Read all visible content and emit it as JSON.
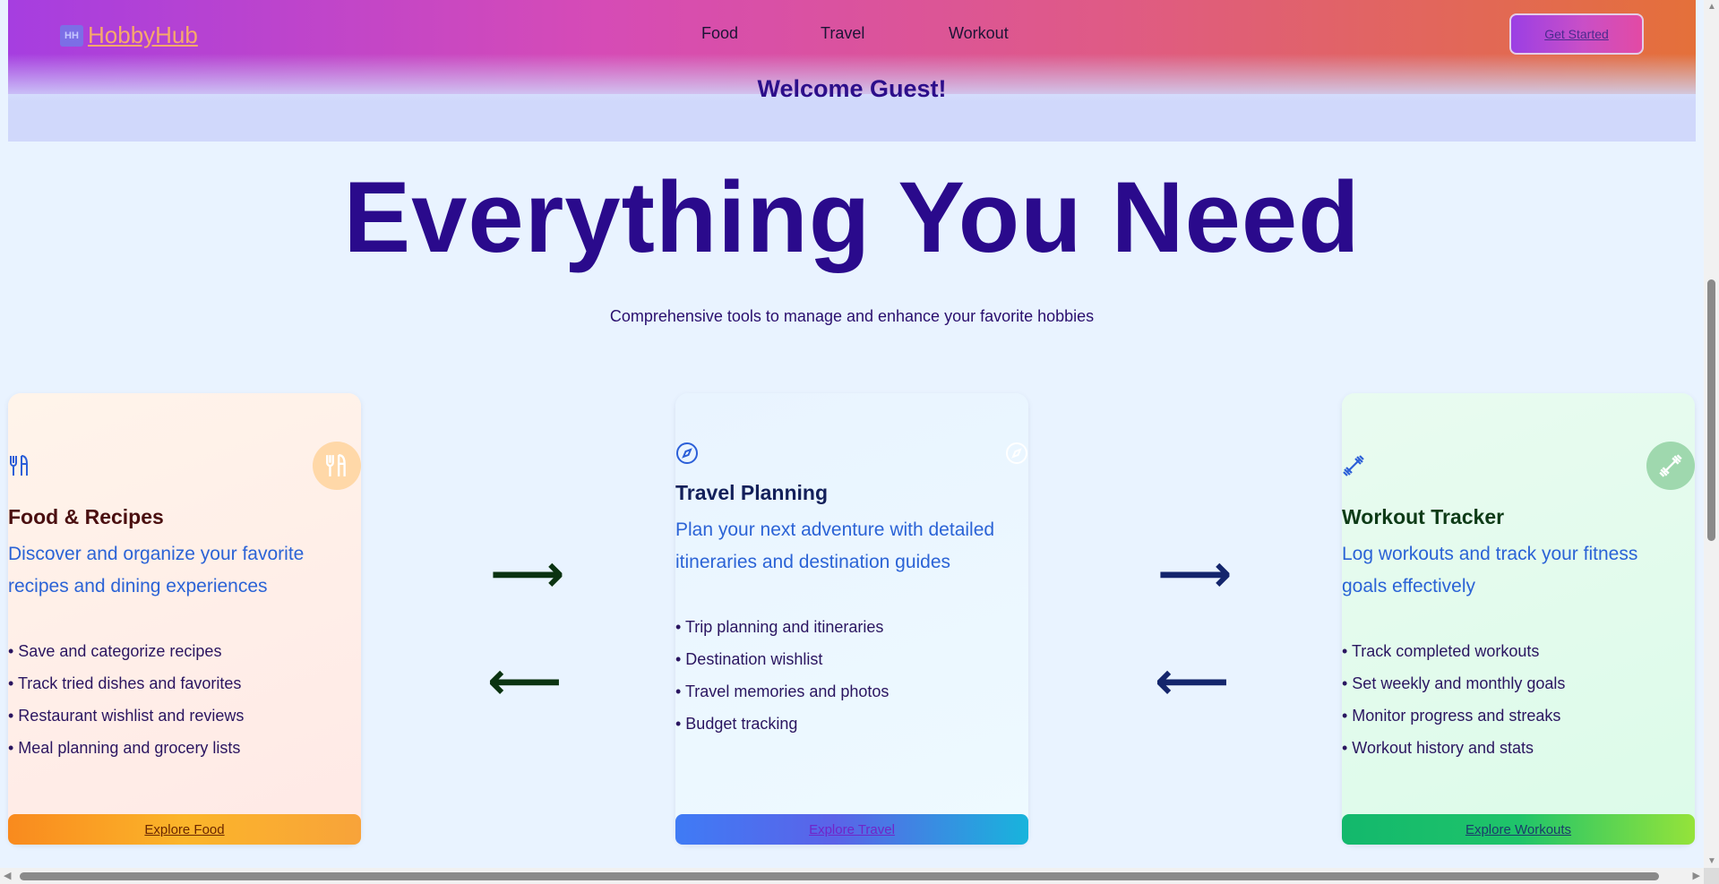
{
  "header": {
    "logo_mark": "HH",
    "logo_text": "HobbyHub",
    "nav": [
      "Food",
      "Travel",
      "Workout"
    ],
    "cta_label": "Get Started",
    "welcome": "Welcome Guest!"
  },
  "hero": {
    "title": "Everything You Need",
    "subtitle": "Comprehensive tools to manage and enhance your favorite hobbies"
  },
  "cards": [
    {
      "icon": "fork-knife-icon",
      "title": "Food & Recipes",
      "description": "Discover and organize your favorite recipes and dining experiences",
      "features": [
        "• Save and categorize recipes",
        "• Track tried dishes and favorites",
        "• Restaurant wishlist and reviews",
        "• Meal planning and grocery lists"
      ],
      "button": "Explore Food"
    },
    {
      "icon": "compass-icon",
      "title": "Travel Planning",
      "description": "Plan your next adventure with detailed itineraries and destination guides",
      "features": [
        "• Trip planning and itineraries",
        "• Destination wishlist",
        "• Travel memories and photos",
        "• Budget tracking"
      ],
      "button": "Explore Travel"
    },
    {
      "icon": "dumbbell-icon",
      "title": "Workout Tracker",
      "description": "Log workouts and track your fitness goals effectively",
      "features": [
        "• Track completed workouts",
        "• Set weekly and monthly goals",
        "• Monitor progress and streaks",
        "• Workout history and stats"
      ],
      "button": "Explore Workouts"
    }
  ],
  "arrows": {
    "right": "⟶",
    "left": "⟵"
  },
  "colors": {
    "brand_title": "#2a0a8c",
    "desc_blue": "#2b63d6"
  }
}
